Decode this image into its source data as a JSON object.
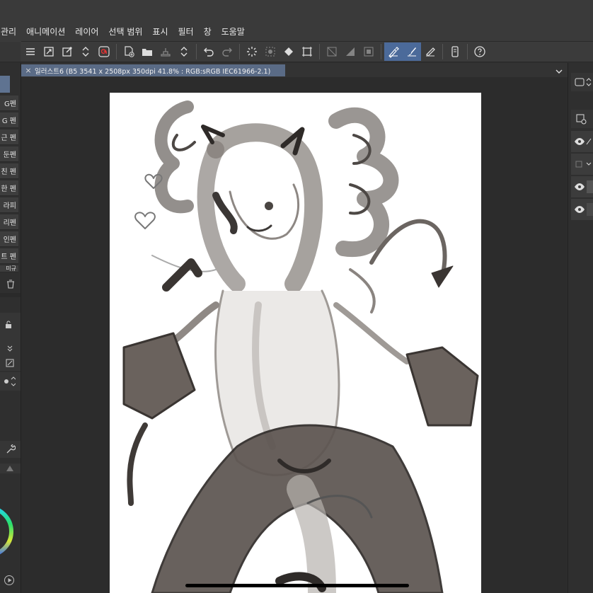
{
  "menu": {
    "items": [
      {
        "label": "관리"
      },
      {
        "label": "애니메이션"
      },
      {
        "label": "레이어"
      },
      {
        "label": "선택 범위"
      },
      {
        "label": "표시"
      },
      {
        "label": "필터"
      },
      {
        "label": "창"
      },
      {
        "label": "도움말"
      }
    ]
  },
  "document": {
    "tab_title": "일러스트6 (B5 3541 x 2508px 350dpi 41.8% : RGB:sRGB IEC61966-2.1)",
    "close_glyph": "×"
  },
  "brushes": {
    "items": [
      {
        "label": "G펜"
      },
      {
        "label": "G 펜"
      },
      {
        "label": "근 펜"
      },
      {
        "label": "둔펜"
      },
      {
        "label": "친 펜"
      },
      {
        "label": "한 펜"
      },
      {
        "label": "라피"
      },
      {
        "label": "리펜"
      },
      {
        "label": "인펜"
      },
      {
        "label": "트 펜"
      },
      {
        "label": "미규"
      }
    ]
  },
  "colors": {
    "accent": "#5a6b86",
    "selected_tool": "#4b6a9a",
    "background": "#2e2e2e",
    "paper": "#ffffff"
  },
  "icons": {
    "command_bar": [
      "menu-icon",
      "canvas-size-icon",
      "transform-icon",
      "chevrons-icon",
      "spiral-icon",
      "new-page-icon",
      "open-folder-icon",
      "stamp-icon",
      "undo-icon",
      "redo-icon",
      "loading-icon",
      "fill-icon",
      "bucket-icon",
      "crop-icon",
      "ruler-icon",
      "pen-icon",
      "brush-icon",
      "eraser-icon",
      "device-icon",
      "help-icon"
    ]
  }
}
